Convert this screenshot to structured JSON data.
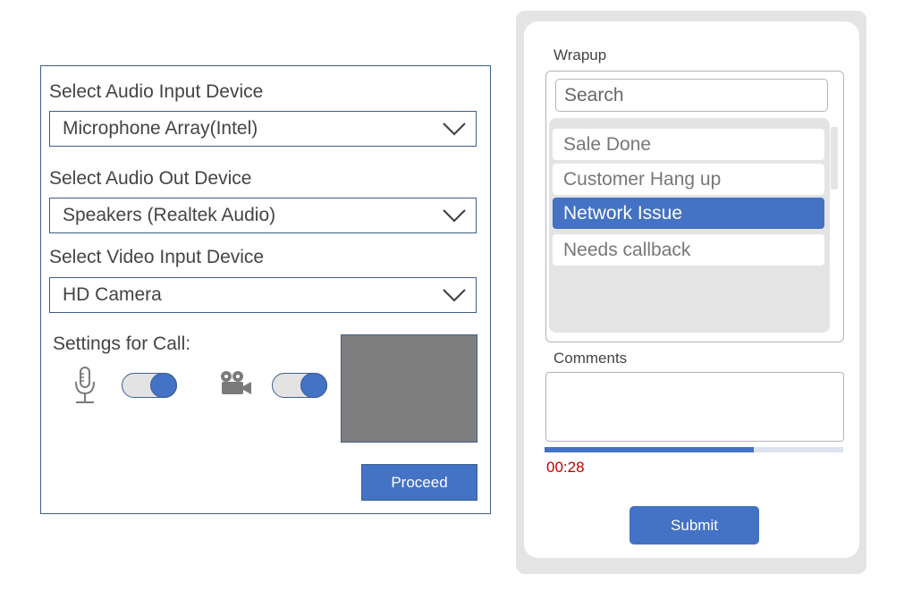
{
  "device_settings": {
    "audio_input": {
      "label": "Select Audio Input Device",
      "value": "Microphone Array(Intel)"
    },
    "audio_output": {
      "label": "Select Audio Out Device",
      "value": "Speakers (Realtek Audio)"
    },
    "video_input": {
      "label": "Select Video Input Device",
      "value": "HD Camera"
    },
    "call_settings_label": "Settings for Call:",
    "mic_toggle_on": true,
    "camera_toggle_on": true,
    "proceed_label": "Proceed",
    "icons": [
      "microphone-icon",
      "video-camera-icon",
      "chevron-down-icon"
    ]
  },
  "wrapup": {
    "title": "Wrapup",
    "search_placeholder": "Search",
    "items": [
      {
        "label": "Sale Done",
        "selected": false
      },
      {
        "label": "Customer Hang up",
        "selected": false
      },
      {
        "label": "Network Issue",
        "selected": true
      },
      {
        "label": "Needs callback",
        "selected": false
      }
    ],
    "comments_label": "Comments",
    "comments_value": "",
    "timer": "00:28",
    "timer_progress_percent": 70,
    "submit_label": "Submit",
    "colors": {
      "accent": "#4472c4",
      "timer": "#c00000",
      "panel": "#e4e4e4"
    }
  }
}
